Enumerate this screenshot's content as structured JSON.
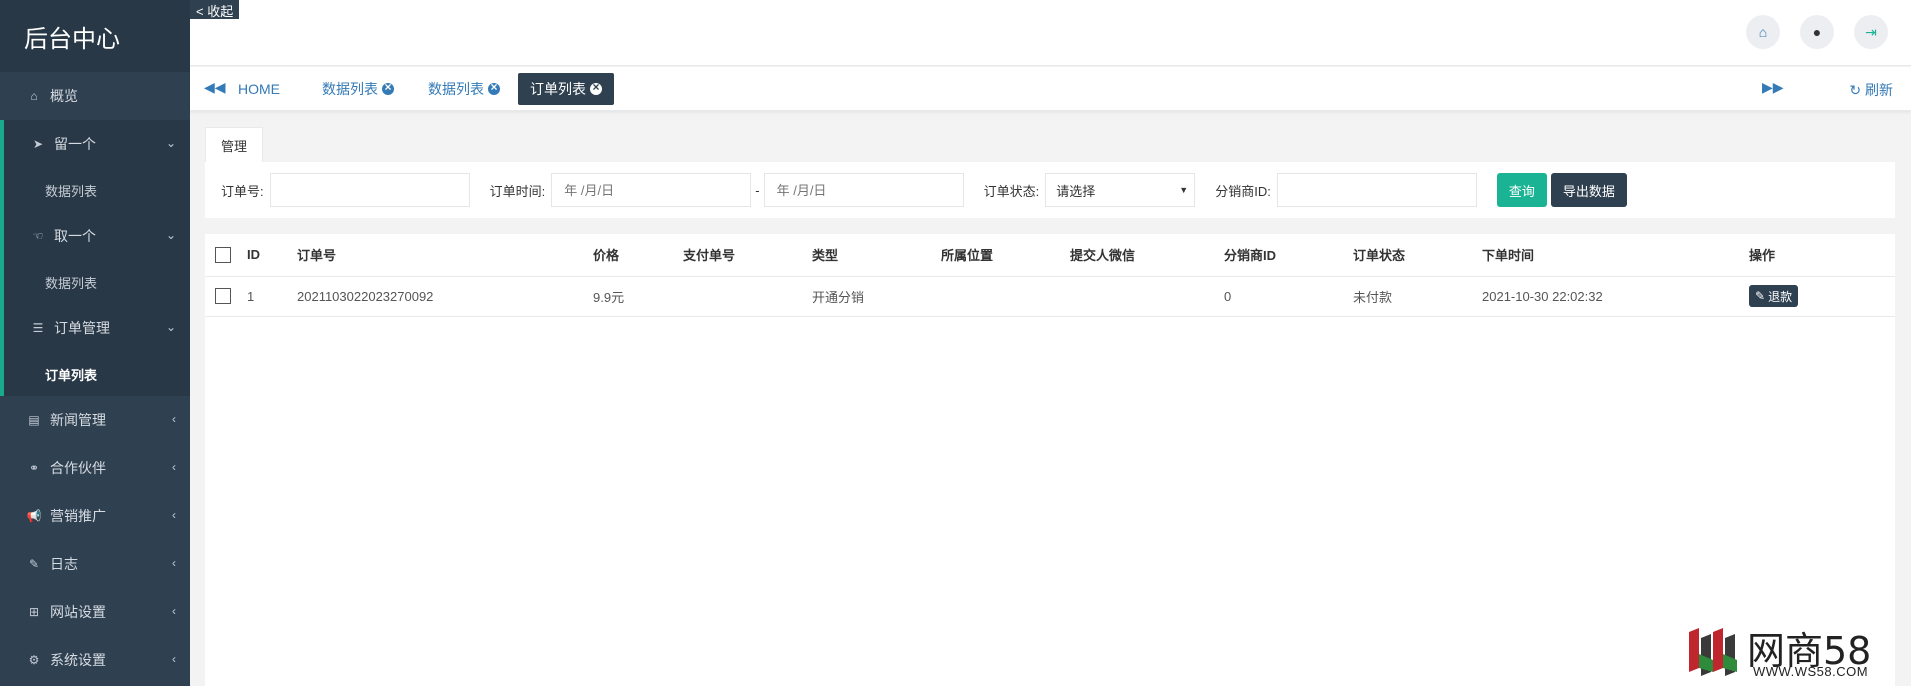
{
  "sidebar": {
    "brand": "后台中心",
    "overview": "概览",
    "groups": [
      {
        "label": "留一个",
        "sub": "数据列表"
      },
      {
        "label": "取一个",
        "sub": "数据列表"
      },
      {
        "label": "订单管理",
        "sub": "订单列表"
      }
    ],
    "items": [
      "新闻管理",
      "合作伙伴",
      "营销推广",
      "日志",
      "网站设置",
      "系统设置"
    ]
  },
  "collapse_label": "< 收起",
  "tabs": {
    "home": "HOME",
    "t1": "数据列表",
    "t2": "数据列表",
    "t3": "订单列表",
    "refresh": "刷新"
  },
  "panel": {
    "tab_label": "管理"
  },
  "filters": {
    "order_no_label": "订单号:",
    "order_time_label": "订单时间:",
    "date_placeholder": "年 /月/日",
    "date_separator": "-",
    "status_label": "订单状态:",
    "status_selected": "请选择",
    "distributor_label": "分销商ID:",
    "query_btn": "查询",
    "export_btn": "导出数据"
  },
  "table": {
    "headers": [
      "ID",
      "订单号",
      "价格",
      "支付单号",
      "类型",
      "所属位置",
      "提交人微信",
      "分销商ID",
      "订单状态",
      "下单时间",
      "操作"
    ],
    "rows": [
      {
        "id": "1",
        "order_no": "2021103022023270092",
        "price": "9.9元",
        "pay_no": "",
        "type": "开通分销",
        "location": "",
        "wechat": "",
        "distributor": "0",
        "status": "未付款",
        "time": "2021-10-30 22:02:32",
        "action": "退款"
      }
    ]
  },
  "logo": {
    "name": "网商58",
    "url": "WWW.WS58.COM"
  },
  "colors": {
    "sidebar": "#2f4050",
    "accent": "#19aa8d",
    "link": "#337ab7",
    "query": "#1ab394"
  }
}
